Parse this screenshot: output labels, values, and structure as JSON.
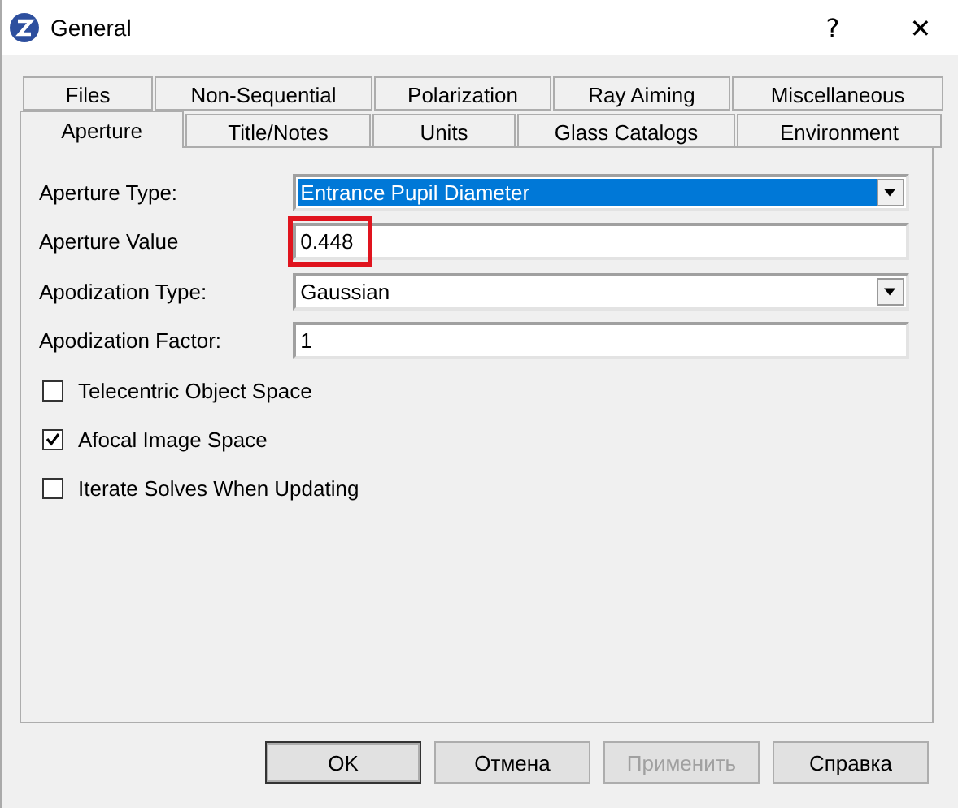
{
  "window": {
    "title": "General",
    "help_glyph": "?",
    "close_glyph": "✕"
  },
  "tab_rows": [
    {
      "tabs": [
        {
          "label": "Files",
          "selected": false
        },
        {
          "label": "Non-Sequential",
          "selected": false
        },
        {
          "label": "Polarization",
          "selected": false
        },
        {
          "label": "Ray Aiming",
          "selected": false
        },
        {
          "label": "Miscellaneous",
          "selected": false
        }
      ]
    },
    {
      "tabs": [
        {
          "label": "Aperture",
          "selected": true
        },
        {
          "label": "Title/Notes",
          "selected": false
        },
        {
          "label": "Units",
          "selected": false
        },
        {
          "label": "Glass Catalogs",
          "selected": false
        },
        {
          "label": "Environment",
          "selected": false
        }
      ]
    }
  ],
  "fields": [
    {
      "kind": "dropdown",
      "label": "Aperture Type:",
      "value": "Entrance Pupil Diameter",
      "focused": true,
      "highlighted": false
    },
    {
      "kind": "text",
      "label": "Aperture Value",
      "value": "0.448",
      "focused": false,
      "highlighted": true
    },
    {
      "kind": "dropdown",
      "label": "Apodization Type:",
      "value": "Gaussian",
      "focused": false,
      "highlighted": false
    },
    {
      "kind": "text",
      "label": "Apodization Factor:",
      "value": "1",
      "focused": false,
      "highlighted": false
    }
  ],
  "checkboxes": [
    {
      "label": "Telecentric Object Space",
      "checked": false
    },
    {
      "label": "Afocal Image Space",
      "checked": true
    },
    {
      "label": "Iterate Solves When Updating",
      "checked": false
    }
  ],
  "buttons": [
    {
      "label": "OK",
      "disabled": false,
      "default": true
    },
    {
      "label": "Отмена",
      "disabled": false,
      "default": false
    },
    {
      "label": "Применить",
      "disabled": true,
      "default": false
    },
    {
      "label": "Справка",
      "disabled": false,
      "default": false
    }
  ]
}
